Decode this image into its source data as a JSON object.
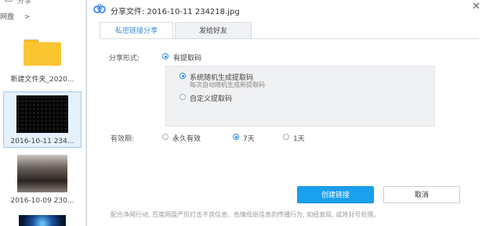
{
  "left_panel": {
    "top_label": "分享",
    "breadcrumb": {
      "root": "网盘",
      "separator": ">"
    },
    "files": [
      {
        "name": "新建文件夹_2020...",
        "type": "folder"
      },
      {
        "name": "2016-10-11 234...",
        "type": "image",
        "selected": true
      },
      {
        "name": "2016-10-09 230...",
        "type": "image"
      },
      {
        "name": "",
        "type": "image"
      }
    ]
  },
  "dialog": {
    "title": "分享文件: 2016-10-11 234218.jpg",
    "tabs": [
      {
        "label": "私密链接分享",
        "active": true
      },
      {
        "label": "发给好友",
        "active": false
      }
    ],
    "share_form": {
      "label": "分享形式:",
      "option": "有提取码",
      "sub_options": [
        {
          "label": "系统随机生成提取码",
          "hint": "每次自动随机生成新提取码",
          "selected": true
        },
        {
          "label": "自定义提取码",
          "selected": false
        }
      ]
    },
    "validity": {
      "label": "有效期:",
      "options": [
        {
          "label": "永久有效",
          "selected": false
        },
        {
          "label": "7天",
          "selected": true
        },
        {
          "label": "1天",
          "selected": false
        }
      ]
    },
    "buttons": {
      "create": "创建链接",
      "cancel": "取消"
    },
    "footer": "配合净网行动, 百度网盘严厉打击不良信息、色情低俗信息的传播行为, 如经发现, 或将封号处理。"
  },
  "colors": {
    "accent": "#1aa0ef",
    "folder": "#fbc532",
    "selected_bg": "#e5f1fd"
  }
}
